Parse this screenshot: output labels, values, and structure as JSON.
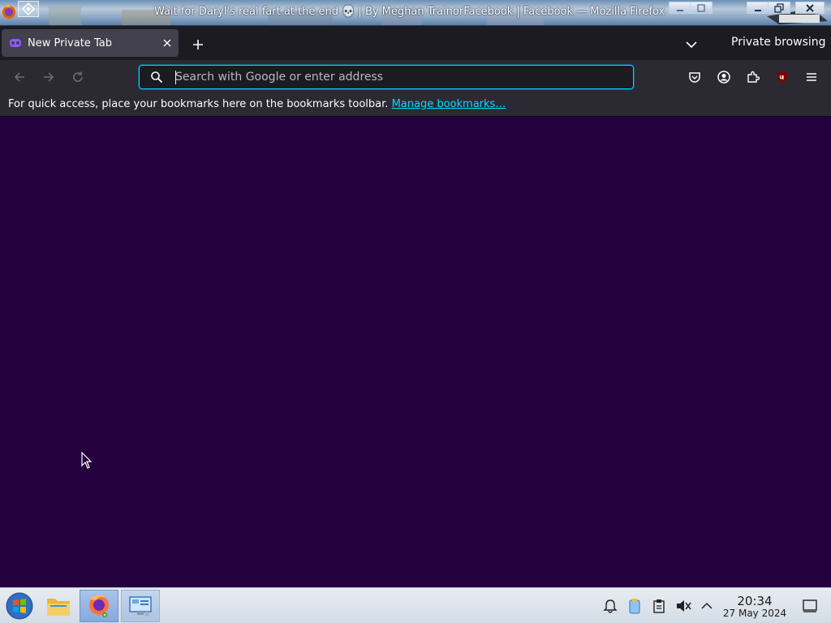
{
  "window": {
    "title": "Wait for Daryl's real fart at the end 💀 | By Meghan TrainorFacebook | Facebook — Mozilla Firefox"
  },
  "tabs": {
    "active_tab_label": "New Private Tab",
    "private_label": "Private browsing"
  },
  "urlbar": {
    "placeholder": "Search with Google or enter address",
    "value": ""
  },
  "bookmarks_toolbar": {
    "message": "For quick access, place your bookmarks here on the bookmarks toolbar.",
    "link": "Manage bookmarks…"
  },
  "taskbar": {
    "time": "20:34",
    "date": "27 May 2024"
  },
  "colors": {
    "content_background": "#25003e",
    "accent": "#00ddff",
    "toolbar": "#2b2a33",
    "tabstrip": "#1c1b22"
  }
}
